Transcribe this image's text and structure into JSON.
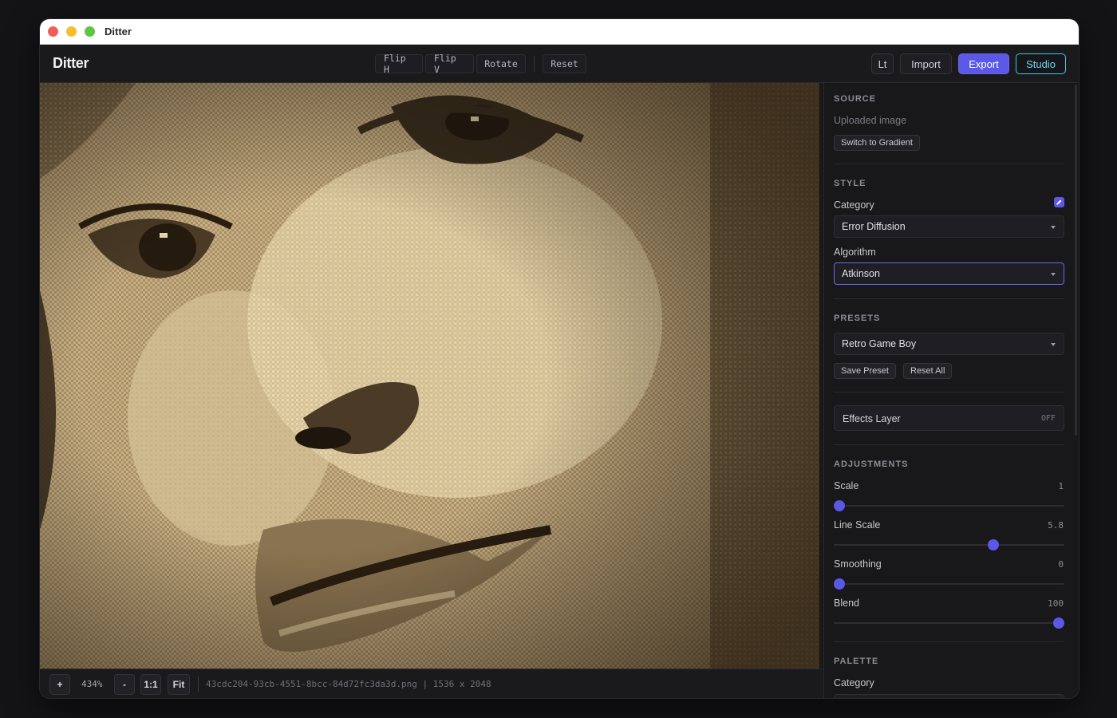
{
  "window": {
    "title": "Ditter"
  },
  "toolbar": {
    "brand": "Ditter",
    "flip_h": "Flip H",
    "flip_v": "Flip V",
    "rotate": "Rotate",
    "reset": "Reset",
    "lt": "Lt",
    "import": "Import",
    "export": "Export",
    "studio": "Studio"
  },
  "status": {
    "zoom_in": "+",
    "zoom": "434%",
    "zoom_out": "-",
    "one_to_one": "1:1",
    "fit": "Fit",
    "file": "43cdc204-93cb-4551-8bcc-84d72fc3da3d.png | 1536 x 2048"
  },
  "panel": {
    "source": {
      "heading": "SOURCE",
      "value": "Uploaded image",
      "switch_button": "Switch to Gradient"
    },
    "style": {
      "heading": "STYLE",
      "category_label": "Category",
      "category_value": "Error Diffusion",
      "algorithm_label": "Algorithm",
      "algorithm_value": "Atkinson"
    },
    "presets": {
      "heading": "PRESETS",
      "value": "Retro Game Boy",
      "save": "Save Preset",
      "reset_all": "Reset All"
    },
    "effects": {
      "label": "Effects Layer",
      "state": "OFF"
    },
    "adjustments": {
      "heading": "ADJUSTMENTS",
      "sliders": [
        {
          "label": "Scale",
          "value": "1",
          "fraction": 0.0
        },
        {
          "label": "Line Scale",
          "value": "5.8",
          "fraction": 0.7
        },
        {
          "label": "Smoothing",
          "value": "0",
          "fraction": 0.0
        },
        {
          "label": "Blend",
          "value": "100",
          "fraction": 1.0
        }
      ]
    },
    "palette": {
      "heading": "PALETTE",
      "category_label": "Category"
    }
  },
  "colors": {
    "accent": "#5b58e8",
    "studio": "#40c8e0",
    "palette_dark": "#3a2e1e",
    "palette_mid": "#7a6648",
    "palette_light": "#b89e74",
    "palette_highlight": "#e6d6b0"
  }
}
